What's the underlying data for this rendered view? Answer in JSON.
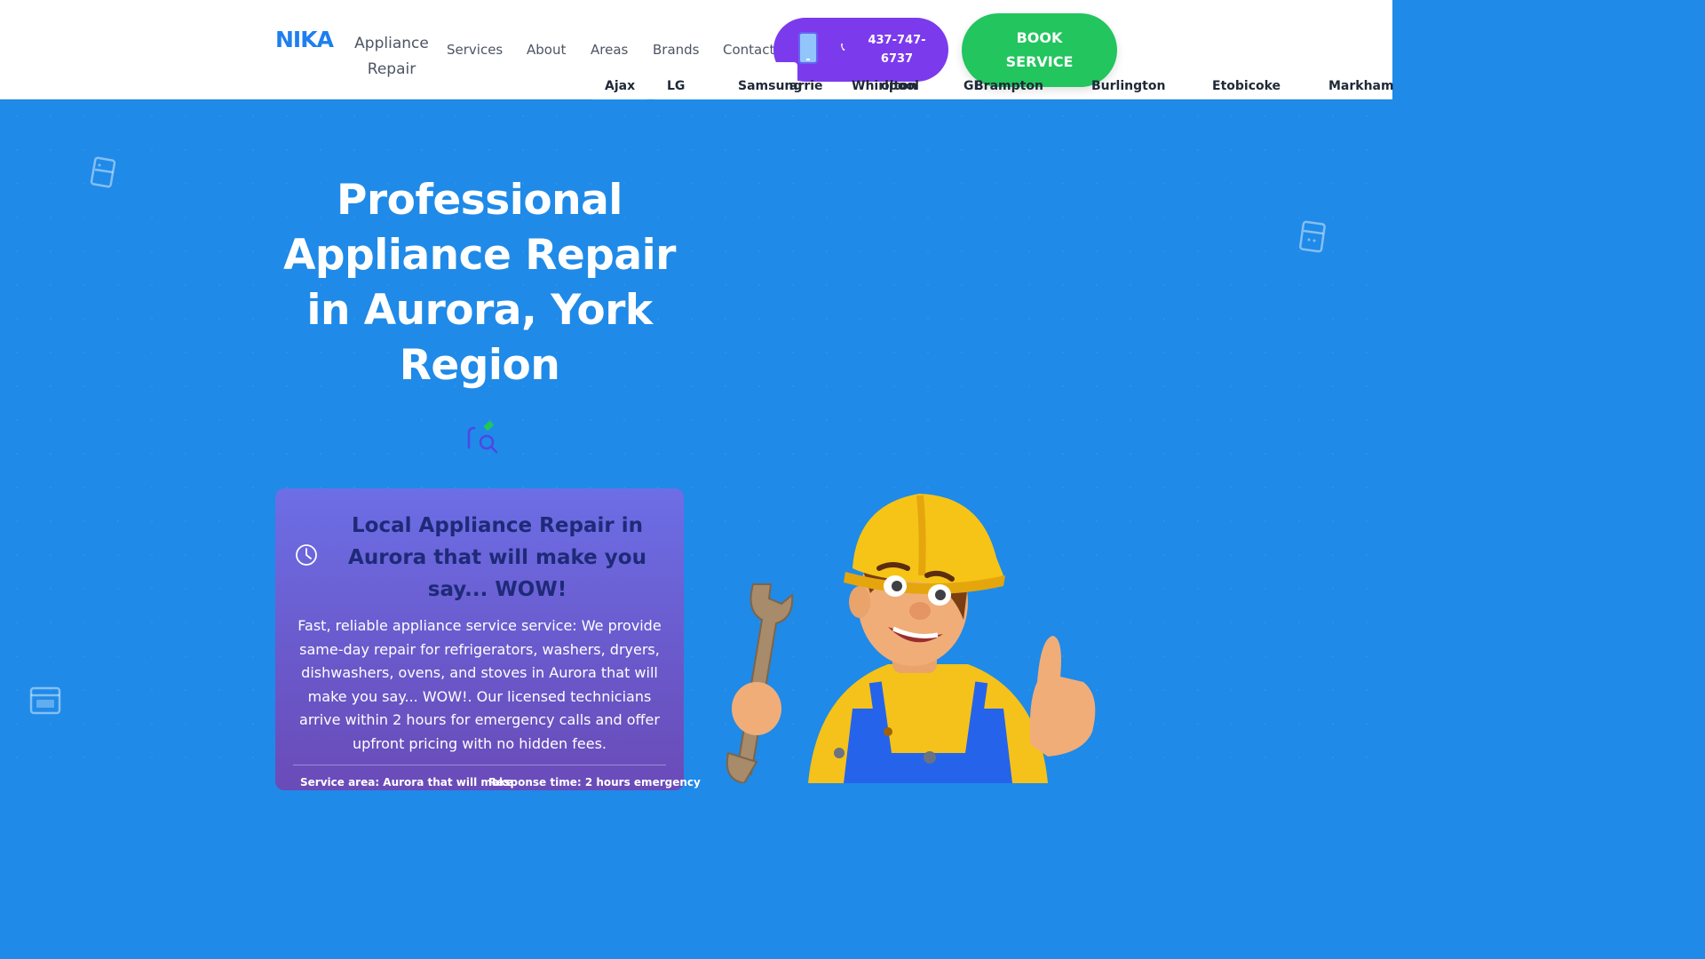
{
  "header": {
    "logo": "NIKA",
    "brand_line1": "Appliance",
    "brand_line2": "Repair",
    "nav": [
      "Services",
      "About",
      "Areas",
      "Brands",
      "Contact"
    ],
    "phone_line1": "437-747-",
    "phone_line2": "6737",
    "book_line1": "BOOK",
    "book_line2": "SERVICE"
  },
  "dropdown_areas": [
    "Ajax",
    "arrie",
    "olton",
    "Brampton",
    "Burlington",
    "Etobicoke",
    "Markham"
  ],
  "dropdown_brands": [
    "LG",
    "Samsung",
    "Whirlpool",
    "GE"
  ],
  "hero": {
    "title": "Professional Appliance Repair in Aurora, York Region"
  },
  "card": {
    "title": "Local Appliance Repair in Aurora that will make you say... WOW!",
    "text": "Fast, reliable appliance service service: We provide same-day repair for refrigerators, washers, dryers, dishwashers, ovens, and stoves in Aurora that will make you say... WOW!. Our licensed technicians arrive within 2 hours for emergency calls and offer upfront pricing with no hidden fees.",
    "footer_left": "Service area: Aurora that will make",
    "footer_right": "Response time: 2 hours emergency"
  },
  "colors": {
    "hero_bg": "#1f8ae8",
    "phone_btn": "#7c3aed",
    "book_btn": "#22c55e",
    "logo": "#1e7ff0",
    "card_title": "#1e2a78"
  }
}
